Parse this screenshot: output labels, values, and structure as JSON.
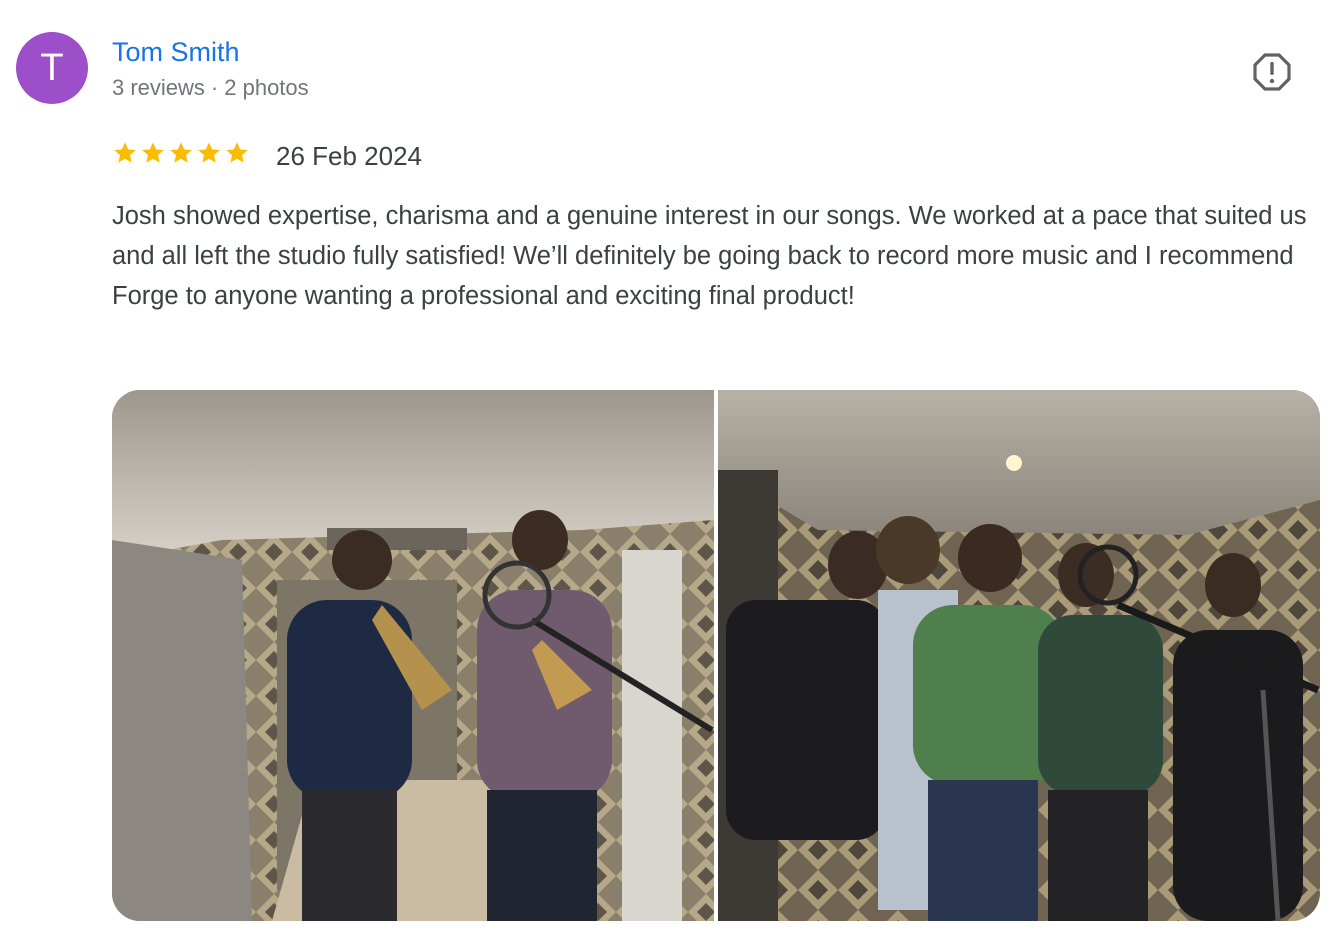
{
  "reviewer": {
    "initial": "T",
    "name": "Tom Smith",
    "reviews": "3 reviews",
    "separator": "·",
    "photos": "2 photos",
    "avatar_color": "#9c4fc8"
  },
  "review": {
    "rating": 5,
    "max_rating": 5,
    "date": "26 Feb 2024",
    "text": "Josh showed expertise, charisma and a genuine interest in our songs. We worked at a pace that suited us and all left the studio fully satisfied! We’ll definitely be going back to record more music and I recommend Forge to anyone wanting a professional and exciting final product!"
  },
  "icons": {
    "report": "report-flag-icon",
    "star": "star-icon"
  },
  "colors": {
    "link": "#1a73e8",
    "star": "#fbbc04",
    "muted": "#70757a"
  },
  "photos_list": [
    {
      "name": "review-photo-trumpet-players"
    },
    {
      "name": "review-photo-band-group"
    }
  ]
}
